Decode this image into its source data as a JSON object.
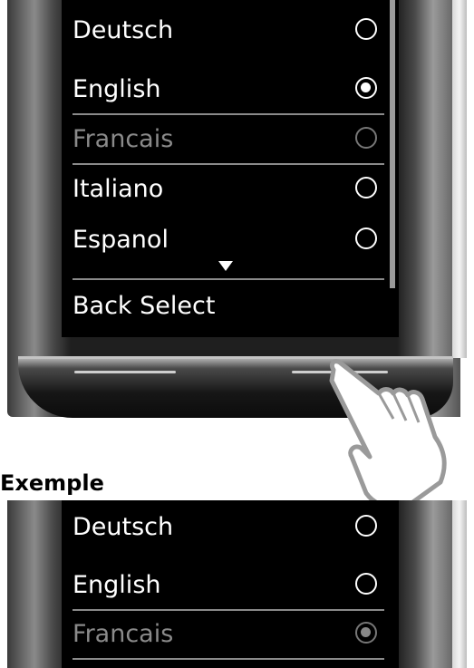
{
  "top_screen": {
    "languages": [
      {
        "label": "Deutsch",
        "selected": false,
        "dim": false
      },
      {
        "label": "English",
        "selected": true,
        "dim": false
      },
      {
        "label": "Francais",
        "selected": false,
        "dim": true
      },
      {
        "label": "Italiano",
        "selected": false,
        "dim": false
      },
      {
        "label": "Espanol",
        "selected": false,
        "dim": false
      }
    ],
    "softkeys": {
      "left": "Back",
      "right": "Select"
    }
  },
  "caption": "Exemple",
  "bottom_screen": {
    "languages": [
      {
        "label": "Deutsch",
        "selected": false,
        "dim": false
      },
      {
        "label": "English",
        "selected": false,
        "dim": false
      },
      {
        "label": "Francais",
        "selected": true,
        "dim": true
      }
    ]
  },
  "icons": {
    "scroll": "scroll-down-arrow-icon",
    "hand": "pointing-hand-icon",
    "radio": "radio-button-icon"
  }
}
